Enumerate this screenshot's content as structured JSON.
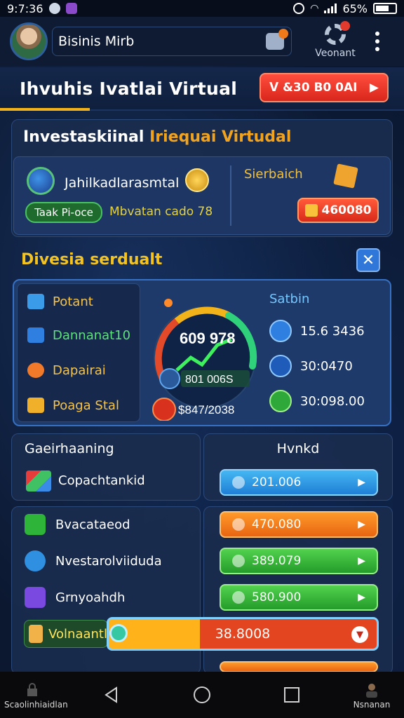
{
  "status": {
    "time": "9:7:36",
    "battery": "65%"
  },
  "header": {
    "user_name": "Bisinis Mirb",
    "settings_label": "Veonant"
  },
  "title_bar": {
    "title": "Ihvuhis  Ivatlai Virtual",
    "cta_label": "ᐯ &30 B0 0AI"
  },
  "overview": {
    "title_white": "Investaskiinal ",
    "title_orange": "Iriequai Virtudal",
    "name": "Jahilkadlarasmtal",
    "tag": "Taak Pi-oce",
    "sub": "Mbvatan cado 78",
    "right_label": "Sierbaich",
    "amount": "460080"
  },
  "diversi": {
    "title": "Divesia serdualt",
    "menu": [
      "Potant",
      "Dannanat10",
      "Dapairai",
      "Poaga Stal"
    ],
    "gauge": {
      "top_value": "609  978",
      "bottom_value": "801  006S",
      "level": 0.68
    },
    "right_title": "Satbin",
    "stats": [
      "15.6 3436",
      "30:0470",
      "30:098.00"
    ],
    "stat_left": "$847/2038"
  },
  "ranking": {
    "left_title": "Gaeirhaaning",
    "left_item": "Copachtankid",
    "right_title": "Hvnkd",
    "right_value": "201.006"
  },
  "list": {
    "rows": [
      "Bvacataeod",
      "Nvestarolviiduda",
      "Grnyoahdh"
    ],
    "values": [
      "470.080",
      "389.079",
      "580.900"
    ]
  },
  "progress": {
    "label": "Volnaantl",
    "value": "38.8008",
    "level": 0.34
  },
  "bottom_nav": {
    "left_label": "Scaolinhiaidlan",
    "right_label": "Nsnanan"
  }
}
